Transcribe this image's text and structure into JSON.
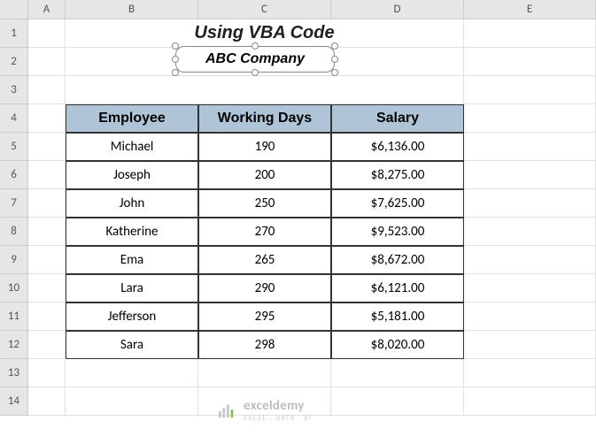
{
  "cols": [
    "A",
    "B",
    "C",
    "D",
    "E"
  ],
  "rows": [
    "1",
    "2",
    "3",
    "4",
    "5",
    "6",
    "7",
    "8",
    "9",
    "10",
    "11",
    "12",
    "13",
    "14"
  ],
  "title": "Using VBA Code",
  "shape_text": "ABC Company",
  "headers": {
    "b": "Employee",
    "c": "Working Days",
    "d": "Salary"
  },
  "data": [
    {
      "emp": "Michael",
      "days": "190",
      "sal": "$6,136.00"
    },
    {
      "emp": "Joseph",
      "days": "200",
      "sal": "$8,275.00"
    },
    {
      "emp": "John",
      "days": "250",
      "sal": "$7,625.00"
    },
    {
      "emp": "Katherine",
      "days": "270",
      "sal": "$9,523.00"
    },
    {
      "emp": "Ema",
      "days": "265",
      "sal": "$8,672.00"
    },
    {
      "emp": "Lara",
      "days": "290",
      "sal": "$6,121.00"
    },
    {
      "emp": "Jefferson",
      "days": "295",
      "sal": "$5,181.00"
    },
    {
      "emp": "Sara",
      "days": "298",
      "sal": "$8,020.00"
    }
  ],
  "watermark": {
    "brand": "exceldemy",
    "tag": "EXCEL · DATA · BI"
  }
}
